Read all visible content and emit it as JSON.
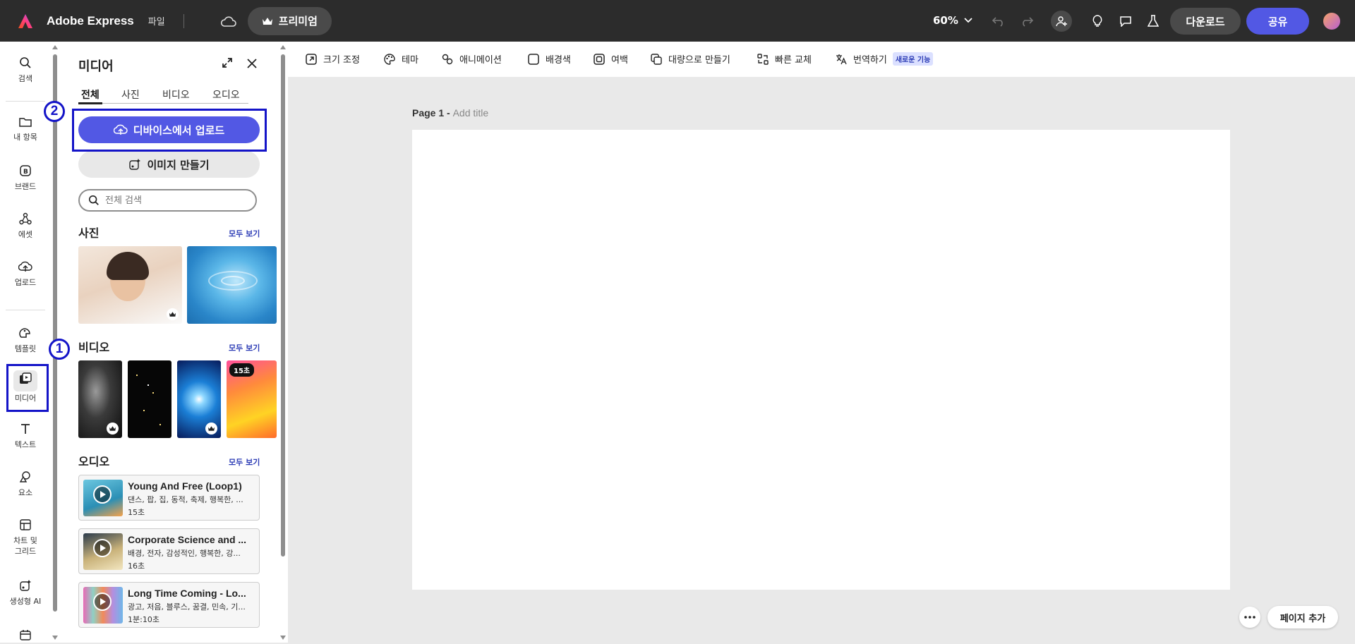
{
  "topbar": {
    "app_name": "Adobe Express",
    "file_menu": "파일",
    "premium": "프리미엄",
    "zoom": "60%",
    "download": "다운로드",
    "share": "공유"
  },
  "rail": {
    "items": [
      {
        "label": "검색",
        "icon": "search-icon"
      },
      {
        "label": "내 항목",
        "icon": "folder-icon"
      },
      {
        "label": "브랜드",
        "icon": "brand-icon"
      },
      {
        "label": "에셋",
        "icon": "assets-icon"
      },
      {
        "label": "업로드",
        "icon": "cloud-upload-icon"
      },
      {
        "label": "템플릿",
        "icon": "template-icon"
      },
      {
        "label": "미디어",
        "icon": "media-icon"
      },
      {
        "label": "텍스트",
        "icon": "text-icon"
      },
      {
        "label": "요소",
        "icon": "shapes-icon"
      },
      {
        "label": "차트 및 그리드",
        "icon": "grid-icon"
      },
      {
        "label": "생성형 AI",
        "icon": "generative-ai-icon"
      }
    ],
    "rail_item_chart_line1": "차트 및",
    "rail_item_chart_line2": "그리드"
  },
  "annotations": {
    "badge1": "1",
    "badge2": "2"
  },
  "panel": {
    "title": "미디어",
    "tabs": [
      "전체",
      "사진",
      "비디오",
      "오디오"
    ],
    "upload_button": "디바이스에서 업로드",
    "generate_button": "이미지 만들기",
    "search_placeholder": "전체 검색",
    "photos_title": "사진",
    "videos_title": "비디오",
    "audio_title": "오디오",
    "see_all": "모두 보기",
    "video_duration": "15초",
    "audio_items": [
      {
        "title": "Young And Free (Loop1)",
        "tags": "댄스, 팝, 집, 동적, 축제, 행복한, ...",
        "duration": "15초"
      },
      {
        "title": "Corporate Science and ...",
        "tags": "배경, 전자, 감성적인, 행복한, 강...",
        "duration": "16초"
      },
      {
        "title": "Long Time Coming - Lo...",
        "tags": "광고, 저음, 블루스, 꿈결, 민속, 기...",
        "duration": "1분:10초"
      }
    ]
  },
  "toolbar": {
    "resize": "크기 조정",
    "theme": "테마",
    "animation": "애니메이션",
    "background": "배경색",
    "margin": "여백",
    "bulk_create": "대량으로 만들기",
    "quick_replace": "빠른 교체",
    "translate": "번역하기",
    "new_feature": "새로운 기능"
  },
  "canvas": {
    "page_label": "Page 1 -",
    "title_placeholder": "Add title",
    "add_page": "페이지 추가"
  },
  "colors": {
    "accent": "#5258e4",
    "annotation": "#1414c8",
    "topbar": "#2c2c2c"
  }
}
